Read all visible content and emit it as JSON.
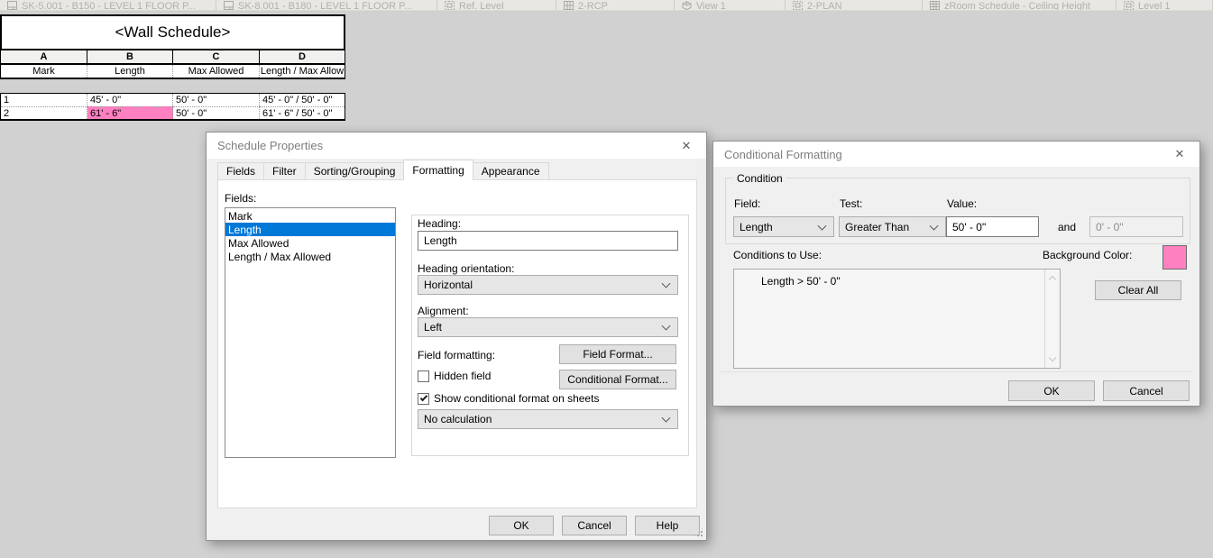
{
  "colors": {
    "highlight_pink": "#FF80C0",
    "selection_blue": "#0078D7"
  },
  "tab_bar": {
    "tabs": [
      {
        "label": "SK-5.001 - B150 - LEVEL 1 FLOOR P...",
        "icon": "sheet-icon"
      },
      {
        "label": "SK-8.001 - B180 - LEVEL 1 FLOOR P...",
        "icon": "sheet-icon"
      },
      {
        "label": "Ref. Level",
        "icon": "plan-icon"
      },
      {
        "label": "2-RCP",
        "icon": "rcp-icon"
      },
      {
        "label": "View 1",
        "icon": "view3d-icon"
      },
      {
        "label": "2-PLAN",
        "icon": "plan-icon"
      },
      {
        "label": "zRoom Schedule - Ceiling Height",
        "icon": "schedule-icon"
      },
      {
        "label": "Level 1",
        "icon": "plan-icon"
      }
    ]
  },
  "schedule": {
    "title": "<Wall Schedule>",
    "column_letters": [
      "A",
      "B",
      "C",
      "D"
    ],
    "headers": [
      "Mark",
      "Length",
      "Max Allowed",
      "Length / Max Allow"
    ],
    "rows": [
      {
        "cells": [
          "1",
          "45' - 0\"",
          "50' - 0\"",
          "45' - 0\" / 50' - 0\""
        ]
      },
      {
        "cells": [
          "2",
          "61' - 6\"",
          "50' - 0\"",
          "61' - 6\" / 50' - 0\""
        ]
      }
    ]
  },
  "schedule_properties": {
    "title": "Schedule Properties",
    "close_glyph": "✕",
    "tabs": [
      "Fields",
      "Filter",
      "Sorting/Grouping",
      "Formatting",
      "Appearance"
    ],
    "fields_label": "Fields:",
    "fields": [
      "Mark",
      "Length",
      "Max Allowed",
      "Length / Max Allowed"
    ],
    "selected_field": "Length",
    "heading_label": "Heading:",
    "heading_value": "Length",
    "heading_orientation_label": "Heading orientation:",
    "heading_orientation_value": "Horizontal",
    "alignment_label": "Alignment:",
    "alignment_value": "Left",
    "field_formatting_label": "Field formatting:",
    "field_format_button": "Field Format...",
    "hidden_field_label": "Hidden field",
    "conditional_format_button": "Conditional Format...",
    "show_conditional_label": "Show conditional format on sheets",
    "calculation_value": "No calculation",
    "ok": "OK",
    "cancel": "Cancel",
    "help": "Help"
  },
  "conditional_formatting": {
    "title": "Conditional Formatting",
    "close_glyph": "✕",
    "condition_group_label": "Condition",
    "field_label": "Field:",
    "field_value": "Length",
    "test_label": "Test:",
    "test_value": "Greater Than",
    "value_label": "Value:",
    "value_value": "50' - 0\"",
    "and_label": "and",
    "and_value": "0' - 0\"",
    "conditions_label": "Conditions to Use:",
    "conditions": [
      "Length > 50' - 0\""
    ],
    "background_color_label": "Background Color:",
    "clear_all": "Clear All",
    "ok": "OK",
    "cancel": "Cancel"
  }
}
